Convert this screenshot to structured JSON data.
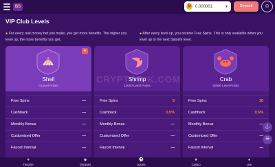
{
  "header": {
    "logo_text": "BS",
    "balance": "0.000001",
    "coin_symbol": "₿",
    "deposit_label": "Deposit"
  },
  "page": {
    "title": "VIP Club Levels",
    "info_left_pre": "For every real money bet you make, you get more benefits. The higher you level up, the more benefits you get.",
    "info_right": "After every level up, you receive Free Spins. This is only available when you level up to the next Satoshi level."
  },
  "watermark": "CRYPTOBIK.COM",
  "levels": [
    {
      "name": "Shell",
      "points": "0 Level Points",
      "current_badge": "★",
      "rows": [
        {
          "label": "Free Spins",
          "value": "—"
        },
        {
          "label": "Cashback",
          "value": "—"
        },
        {
          "label": "Monthly Bonus",
          "value": "—"
        },
        {
          "label": "Customized Offer",
          "value": "—"
        },
        {
          "label": "Faucet Interval",
          "value": "—"
        }
      ]
    },
    {
      "name": "Shrimp",
      "points": "10000 Level Points",
      "rows": [
        {
          "label": "Free Spins",
          "value": "5"
        },
        {
          "label": "Cashback",
          "value": "0.5%"
        },
        {
          "label": "Monthly Bonus",
          "value": "—"
        },
        {
          "label": "Customized Offer",
          "value": "—"
        },
        {
          "label": "Faucet Interval",
          "value": "—"
        }
      ]
    },
    {
      "name": "Crab",
      "points": "50000 Level Points",
      "rows": [
        {
          "label": "Free Spins",
          "value": "10"
        },
        {
          "label": "Cashback",
          "value": "0.5%"
        },
        {
          "label": "Monthly Bonus",
          "value": "—"
        },
        {
          "label": "Customized Offer",
          "value": "—"
        },
        {
          "label": "Faucet Interval",
          "value": "—"
        }
      ]
    }
  ],
  "nav": [
    {
      "label": "Favorite",
      "icon": "heart-icon",
      "glyph": "♥"
    },
    {
      "label": "Originals",
      "icon": "originals-icon",
      "glyph": "◆"
    },
    {
      "label": "Sports",
      "icon": "sports-icon",
      "glyph": "⚽"
    },
    {
      "label": "Casino",
      "icon": "casino-icon",
      "glyph": "♣"
    },
    {
      "label": "Live",
      "icon": "live-icon",
      "glyph": "●"
    }
  ],
  "colors": {
    "background": "#3a1263",
    "card": "#4a1a7a",
    "accent": "#ff8a3a",
    "deposit": "#f07a7a"
  }
}
